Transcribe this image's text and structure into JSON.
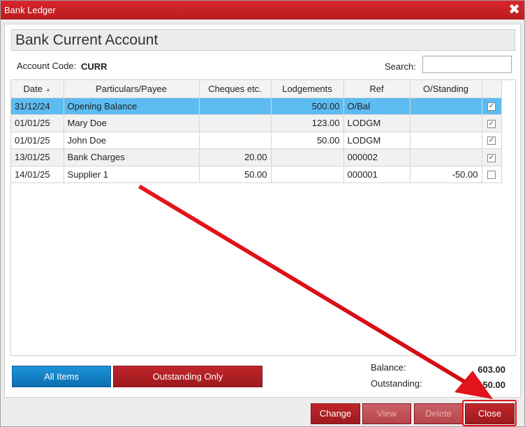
{
  "window": {
    "title": "Bank Ledger",
    "close_glyph": "✖"
  },
  "header": {
    "heading": "Bank Current Account",
    "account_code_label": "Account Code:",
    "account_code": "CURR",
    "search_label": "Search:",
    "search_value": ""
  },
  "table": {
    "columns": [
      "Date",
      "Particulars/Payee",
      "Cheques etc.",
      "Lodgements",
      "Ref",
      "O/Standing",
      ""
    ],
    "rows": [
      {
        "date": "31/12/24",
        "particulars": "Opening Balance",
        "cheques": "",
        "lodgements": "500.00",
        "ref": "O/Bal",
        "outstanding": "",
        "checked": true,
        "selected": true
      },
      {
        "date": "01/01/25",
        "particulars": "Mary Doe",
        "cheques": "",
        "lodgements": "123.00",
        "ref": "LODGM",
        "outstanding": "",
        "checked": true
      },
      {
        "date": "01/01/25",
        "particulars": "John Doe",
        "cheques": "",
        "lodgements": "50.00",
        "ref": "LODGM",
        "outstanding": "",
        "checked": true
      },
      {
        "date": "13/01/25",
        "particulars": "Bank Charges",
        "cheques": "20.00",
        "lodgements": "",
        "ref": "000002",
        "outstanding": "",
        "checked": true
      },
      {
        "date": "14/01/25",
        "particulars": "Supplier 1",
        "cheques": "50.00",
        "lodgements": "",
        "ref": "000001",
        "outstanding": "-50.00",
        "checked": false
      }
    ]
  },
  "filters": {
    "all_items": "All Items",
    "outstanding_only": "Outstanding Only"
  },
  "totals": {
    "balance_label": "Balance:",
    "balance": "603.00",
    "outstanding_label": "Outstanding:",
    "outstanding": "-50.00"
  },
  "buttons": {
    "change": "Change",
    "view": "View",
    "delete": "Delete",
    "close": "Close"
  },
  "colors": {
    "titlebar": "#c8202a",
    "accent_blue": "#1383c9",
    "button_red": "#b01f24",
    "selected_row": "#5cbcf2",
    "annotation": "#e0141a"
  }
}
